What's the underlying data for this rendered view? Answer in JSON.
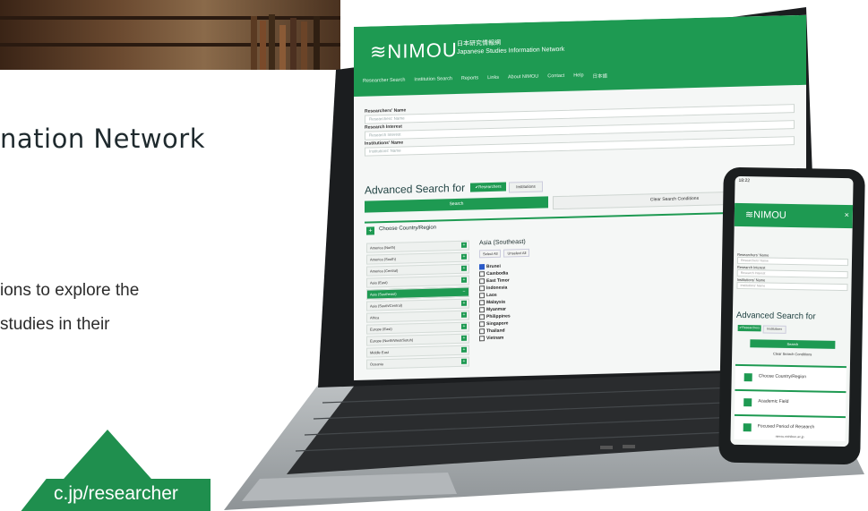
{
  "page": {
    "heading": "nation Network",
    "desc_line1": "ions to explore the",
    "desc_line2": "studies in their",
    "url": "c.jp/researcher"
  },
  "laptop": {
    "logo": "≋NIMOU",
    "jp_title": "日本研究情報網",
    "subtitle": "Japanese Studies Information Network",
    "nav": [
      "Researcher Search",
      "Institution Search",
      "Reports",
      "Links",
      "About NIMOU",
      "Contact",
      "Help",
      "日本語"
    ],
    "form": [
      {
        "label": "Researchers' Name",
        "placeholder": "Researchers' Name"
      },
      {
        "label": "Research Interest",
        "placeholder": "Research Interest"
      },
      {
        "label": "Institutions' Name",
        "placeholder": "Institutions' Name"
      }
    ],
    "advanced_title": "Advanced Search for",
    "tab_researchers": "✔Researchers",
    "tab_institutions": "Institutions",
    "search_label": "Search",
    "clear_label": "Clear Search Conditions",
    "choose_label": "Choose Country/Region",
    "regions": [
      {
        "name": "America (North)",
        "selected": false
      },
      {
        "name": "America (South)",
        "selected": false
      },
      {
        "name": "America (Central)",
        "selected": false
      },
      {
        "name": "Asia (East)",
        "selected": false
      },
      {
        "name": "Asia (Southeast)",
        "selected": true
      },
      {
        "name": "Asia (South/Central)",
        "selected": false
      },
      {
        "name": "Africa",
        "selected": false
      },
      {
        "name": "Europe (East)",
        "selected": false
      },
      {
        "name": "Europe (North/West/Sotuh)",
        "selected": false
      },
      {
        "name": "Middle East",
        "selected": false
      },
      {
        "name": "Oceania",
        "selected": false
      }
    ],
    "country_group": "Asia (Southeast)",
    "select_all": "Select All",
    "unselect_all": "Unselect All",
    "countries": [
      {
        "name": "Brunei",
        "checked": true
      },
      {
        "name": "Cambodia",
        "checked": false
      },
      {
        "name": "East Timor",
        "checked": false
      },
      {
        "name": "Indonesia",
        "checked": false
      },
      {
        "name": "Laos",
        "checked": false
      },
      {
        "name": "Malaysia",
        "checked": false
      },
      {
        "name": "Myanmar",
        "checked": false
      },
      {
        "name": "Philippines",
        "checked": false
      },
      {
        "name": "Singapore",
        "checked": false
      },
      {
        "name": "Thailand",
        "checked": false
      },
      {
        "name": "Vietnam",
        "checked": false
      }
    ]
  },
  "phone": {
    "time": "18:22",
    "logo": "≋NIMOU",
    "form": [
      {
        "label": "Researchers' Name",
        "placeholder": "Researchers' Name"
      },
      {
        "label": "Research Interest",
        "placeholder": "Research Interest"
      },
      {
        "label": "Institutions' Name",
        "placeholder": "Institutions' Name"
      }
    ],
    "advanced_title": "Advanced Search for",
    "tab_researchers": "✔Researchers",
    "tab_institutions": "Institutions",
    "search_label": "Search",
    "clear_label": "Clear Search Conditions",
    "sections": [
      "Choose Country/Region",
      "Academic Field",
      "Focused Period of Research"
    ],
    "url": "nimou.nichibun.ac.jp"
  },
  "colors": {
    "brand_green": "#1e9a52",
    "ribbon_green": "#1f8f4e"
  }
}
